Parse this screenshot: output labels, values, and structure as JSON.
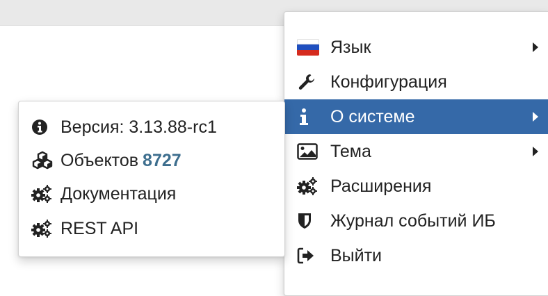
{
  "main_menu": {
    "items": [
      {
        "label": "Язык",
        "icon": "flag-ru-icon",
        "submenu": true
      },
      {
        "label": "Конфигурация",
        "icon": "wrench-icon",
        "submenu": false
      },
      {
        "label": "О системе",
        "icon": "info-icon",
        "submenu": true,
        "active": true
      },
      {
        "label": "Тема",
        "icon": "image-icon",
        "submenu": true
      },
      {
        "label": "Расширения",
        "icon": "cogs-icon",
        "submenu": false
      },
      {
        "label": "Журнал событий ИБ",
        "icon": "shield-icon",
        "submenu": false
      },
      {
        "label": "Выйти",
        "icon": "sign-out-icon",
        "submenu": false
      }
    ]
  },
  "about_menu": {
    "version_label": "Версия: 3.13.88-rc1",
    "objects_label": "Объектов",
    "objects_count": "8727",
    "docs_label": "Документация",
    "rest_api_label": "REST API"
  },
  "colors": {
    "active_bg": "#3569a8",
    "count_color": "#3d6e8e",
    "flag": [
      "#ffffff",
      "#1f4fbf",
      "#d52b1e"
    ]
  }
}
